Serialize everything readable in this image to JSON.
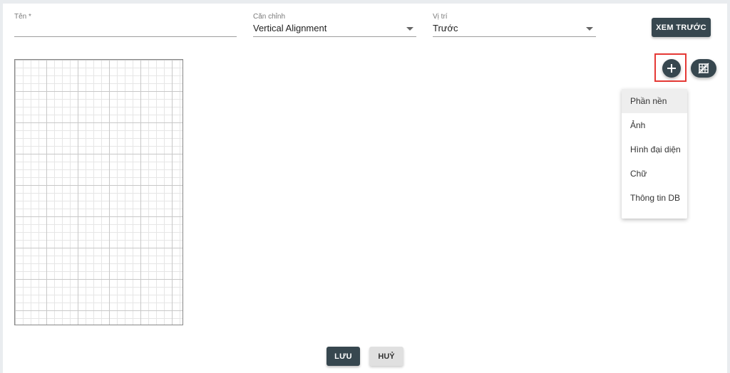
{
  "form": {
    "name": {
      "label": "Tên *",
      "value": ""
    },
    "alignment": {
      "label": "Căn chỉnh",
      "value": "Vertical Alignment"
    },
    "position": {
      "label": "Vị trí",
      "value": "Trước"
    }
  },
  "toolbar": {
    "preview_label": "XEM TRƯỚC",
    "add_icon": "plus-icon",
    "grid_icon": "grid-toggle-icon"
  },
  "add_menu": {
    "items": [
      {
        "label": "Phần nền",
        "active": true
      },
      {
        "label": "Ảnh",
        "active": false
      },
      {
        "label": "Hình đại diện",
        "active": false
      },
      {
        "label": "Chữ",
        "active": false
      },
      {
        "label": "Thông tin DB",
        "active": false
      }
    ]
  },
  "footer": {
    "save_label": "LƯU",
    "cancel_label": "HUỶ"
  },
  "colors": {
    "primary_button": "#37474f",
    "secondary_button": "#e0e0e0",
    "highlight": "#e53935"
  }
}
